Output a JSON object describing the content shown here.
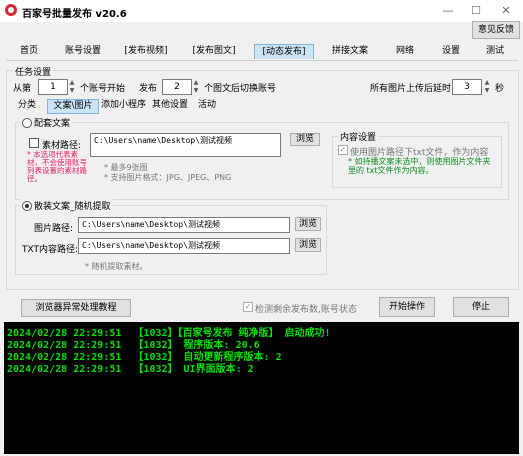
{
  "window": {
    "title": "百家号批量发布  v20.6",
    "feedback_label": "意见反馈",
    "min": "—",
    "max": "☐",
    "close": "✕"
  },
  "tabs": [
    "首页",
    "账号设置",
    "[发布视频]",
    "[发布图文]",
    "[动态发布]",
    "拼接文案",
    "网络",
    "设置",
    "测试"
  ],
  "active_tab": "[动态发布]",
  "task": {
    "group_title": "任务设置",
    "from_label": "从第",
    "from_value": "1",
    "from_suffix": "个账号开始",
    "publish_label": "发布",
    "publish_value": "2",
    "publish_suffix": "个图文后切换账号",
    "delete_label": "所有图片上传后延时",
    "delete_value": "3",
    "delete_suffix": "秒"
  },
  "subtabs": [
    "分类",
    "文案\\图片",
    "添加小程序",
    "其他设置",
    "活动"
  ],
  "active_subtab": "文案\\图片",
  "config": {
    "radio_label": "配套文案",
    "material_checkbox": "素材路径:",
    "material_path": "C:\\Users\\name\\Desktop\\测试视频",
    "browse_label": "浏览",
    "red_note": "* 本选项代表素材，不会使用账号列表设置的素材路径。",
    "hint1": "* 最多9张图",
    "hint2": "* 支持图片格式：JPG、JPEG、PNG",
    "content_group_title": "内容设置",
    "content_checkbox": "使用图片路径下txt文件，作为内容",
    "green_note": "* 如持播文案未选中，则使用图片文件夹里的 txt文件作为内容。"
  },
  "random": {
    "radio_label": "散装文案_随机提取",
    "image_path_label": "图片路径:",
    "image_path": "C:\\Users\\name\\Desktop\\测试视频",
    "txt_path_label": "TXT内容路径:",
    "txt_path": "C:\\Users\\name\\Desktop\\测试视频",
    "browse_label": "浏览",
    "hint": "* 随机提取素材。"
  },
  "footer": {
    "tutorial_label": "浏览器异常处理教程",
    "detect_checkbox": "检测剩余发布数,账号状态",
    "start_label": "开始操作",
    "stop_label": "停止"
  },
  "console": [
    "2024/02/28 22:29:51  【1032】【百家号发布 纯净版】 启动成功!",
    "2024/02/28 22:29:51  【1032】 程序版本: 20.6",
    "2024/02/28 22:29:51  【1032】 自动更新程序版本: 2",
    "2024/02/28 22:29:51  【1032】 UI界面版本: 2"
  ],
  "colors": {
    "accent": "#cce4f7",
    "console_bg": "#000000",
    "console_fg": "#00e000",
    "red_note": "#e0245e",
    "green_note": "#0a8f1a"
  }
}
